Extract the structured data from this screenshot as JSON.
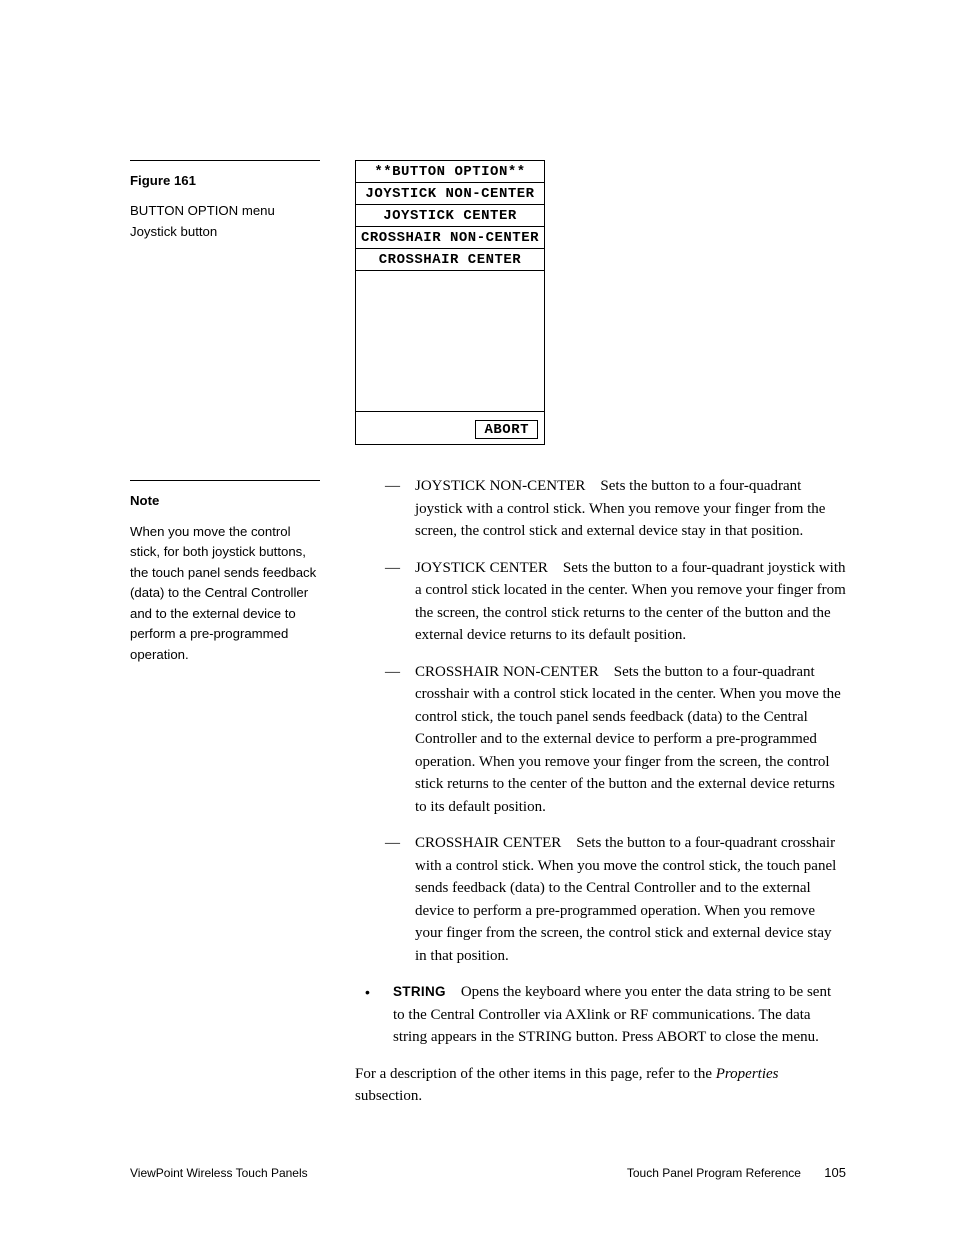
{
  "figure": {
    "label": "Figure 161",
    "caption1": "BUTTON OPTION menu",
    "caption2": "Joystick button"
  },
  "menu": {
    "title": "**BUTTON OPTION**",
    "rows": [
      "JOYSTICK NON-CENTER",
      "JOYSTICK CENTER",
      "CROSSHAIR NON-CENTER",
      "CROSSHAIR CENTER"
    ],
    "abort": "ABORT"
  },
  "note": {
    "label": "Note",
    "text": "When you move the control stick, for both joystick buttons, the touch panel sends feedback (data) to the Central Controller and to the external device to perform a pre-programmed operation."
  },
  "items": {
    "jnc": {
      "lead": "JOYSTICK NON-CENTER",
      "body": "Sets the button to a four-quadrant joystick with a control stick. When you remove your finger from the screen, the control stick and external device stay in that position."
    },
    "jc": {
      "lead": "JOYSTICK CENTER",
      "body": "Sets the button to a four-quadrant joystick with a control stick located in the center. When you remove your finger from the screen, the control stick returns to the center of the button and the external device returns to its default position."
    },
    "cnc": {
      "lead": "CROSSHAIR NON-CENTER",
      "body": "Sets the button to a four-quadrant crosshair with a control stick located in the center. When you move the control stick, the touch panel sends feedback (data) to the Central Controller and to the external device to perform a pre-programmed operation. When you remove your finger from the screen, the control stick returns to the center of the button and the external device returns to its default position."
    },
    "cc": {
      "lead": "CROSSHAIR CENTER",
      "body": "Sets the button to a four-quadrant crosshair with a control stick. When you move the control stick, the touch panel sends feedback (data) to the Central Controller and to the external device to perform a pre-programmed operation. When you remove your finger from the screen, the control stick and external device stay in that position."
    },
    "string": {
      "lead": "STRING",
      "body": "Opens the keyboard where you enter the data string to be sent to the Central Controller via AXlink or RF communications. The data string appears in the STRING button. Press ABORT to close the menu."
    }
  },
  "closing_pre": "For a description of the other items in this page, refer to the ",
  "closing_ital": "Properties",
  "closing_post": " subsection.",
  "footer": {
    "left": "ViewPoint Wireless Touch Panels",
    "right": "Touch Panel Program Reference",
    "page": "105"
  }
}
